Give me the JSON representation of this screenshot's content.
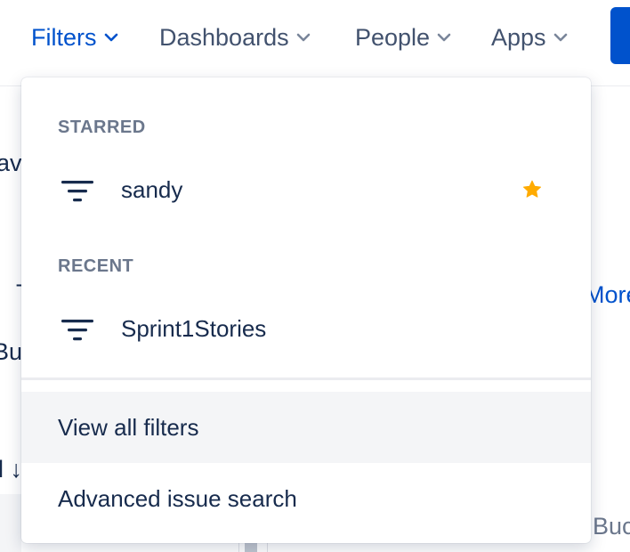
{
  "nav": {
    "filters_label": "Filters",
    "dashboards_label": "Dashboards",
    "people_label": "People",
    "apps_label": "Apps"
  },
  "background": {
    "fragment_1": "ave",
    "fragment_2": "T",
    "fragment_3": "Buc",
    "fragment_4": "More",
    "fragment_5": "l ↓",
    "fragment_6": "Buc"
  },
  "dropdown": {
    "starred_heading": "STARRED",
    "starred_items": [
      {
        "label": "sandy",
        "icon": "filter-lines-icon",
        "starred": true
      }
    ],
    "recent_heading": "RECENT",
    "recent_items": [
      {
        "label": "Sprint1Stories",
        "icon": "filter-lines-icon"
      }
    ],
    "view_all_label": "View all filters",
    "advanced_search_label": "Advanced issue search"
  },
  "colors": {
    "brand_blue": "#0052cc",
    "nav_text": "#42526e",
    "heading_gray": "#6b778c",
    "body_text": "#172b4d",
    "star_orange": "#ffab00",
    "hover_bg": "#f4f5f7"
  }
}
